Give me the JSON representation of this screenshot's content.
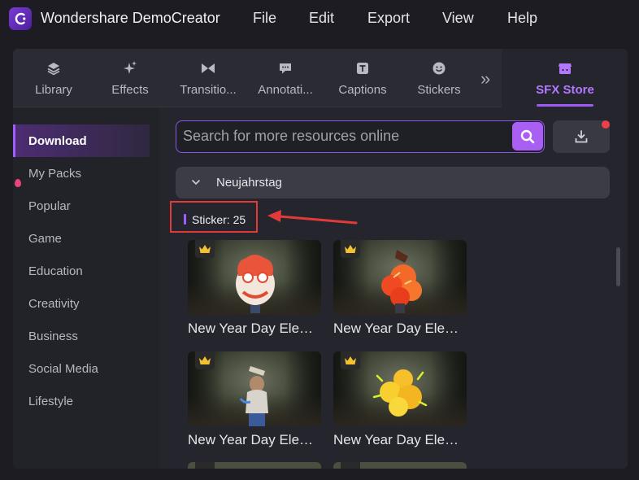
{
  "app": {
    "title": "Wondershare DemoCreator",
    "menu": [
      "File",
      "Edit",
      "Export",
      "View",
      "Help"
    ]
  },
  "tabs": [
    {
      "label": "Library",
      "icon": "layers-icon"
    },
    {
      "label": "Effects",
      "icon": "sparkle-icon"
    },
    {
      "label": "Transitio...",
      "icon": "bowtie-icon"
    },
    {
      "label": "Annotati...",
      "icon": "speech-bubble-icon"
    },
    {
      "label": "Captions",
      "icon": "text-box-icon"
    },
    {
      "label": "Stickers",
      "icon": "smiley-icon"
    },
    {
      "label": "SFX Store",
      "icon": "store-icon",
      "active": true
    }
  ],
  "sidebar": {
    "items": [
      "Download",
      "My Packs",
      "Popular",
      "Game",
      "Education",
      "Creativity",
      "Business",
      "Social Media",
      "Lifestyle"
    ],
    "active": "Download"
  },
  "search": {
    "placeholder": "Search for more resources online"
  },
  "group": {
    "title": "Neujahrstag"
  },
  "sticker": {
    "label": "Sticker: 25"
  },
  "cards": [
    {
      "title": "New Year Day Elem...",
      "variant": "lion"
    },
    {
      "title": "New Year Day Elem...",
      "variant": "firecracker"
    },
    {
      "title": "New Year Day Elem...",
      "variant": "person"
    },
    {
      "title": "New Year Day Elem...",
      "variant": "burst"
    }
  ],
  "colors": {
    "accent": "#a95ff2",
    "annotation": "#e23a3a",
    "badge": "#ee3f4a",
    "crown": "#f2c230"
  }
}
